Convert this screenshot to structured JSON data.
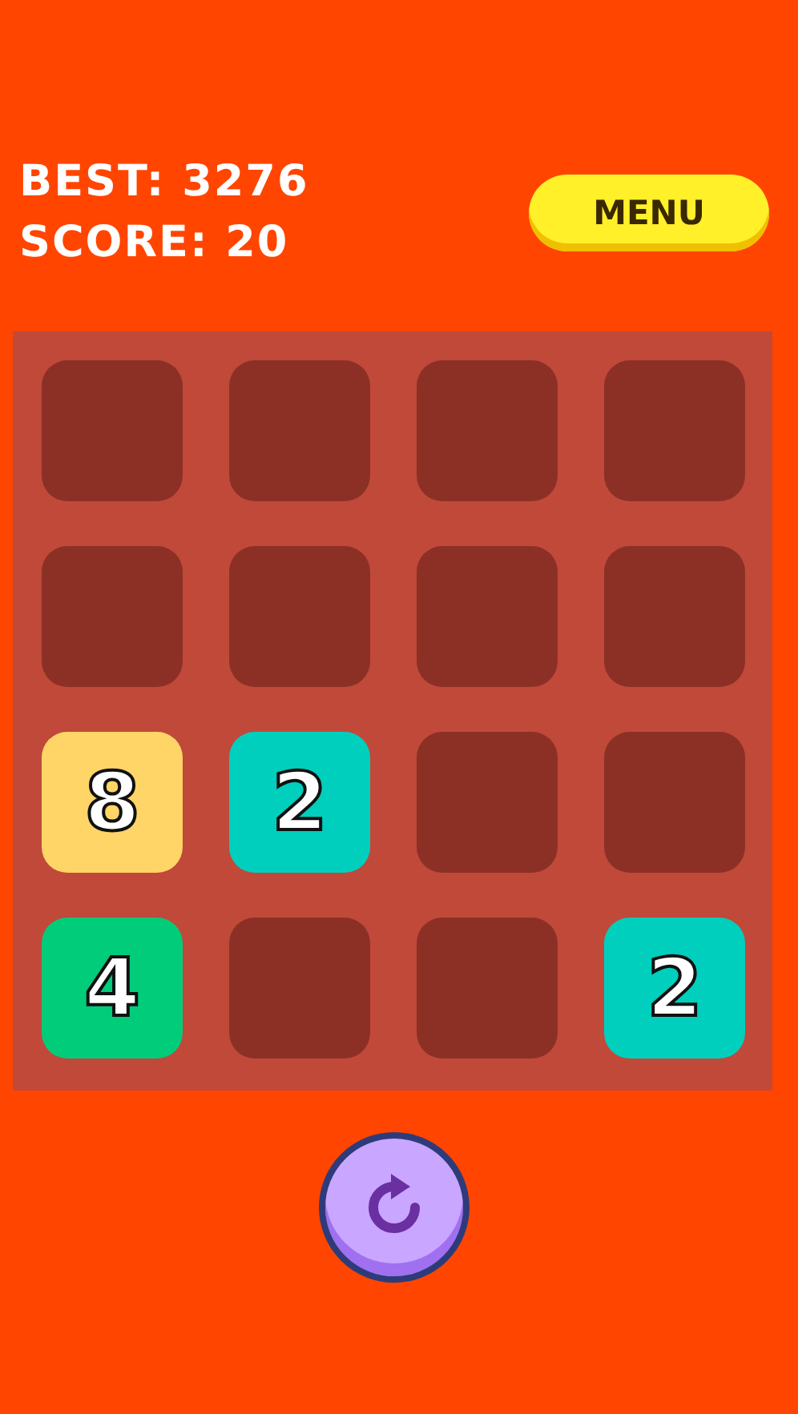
{
  "scores": {
    "best": "BEST: 3276",
    "score": "SCORE: 20"
  },
  "menu_button": {
    "label": "MENU"
  },
  "board": {
    "cells": [
      {
        "kind": "empty"
      },
      {
        "kind": "empty"
      },
      {
        "kind": "empty"
      },
      {
        "kind": "empty"
      },
      {
        "kind": "empty"
      },
      {
        "kind": "empty"
      },
      {
        "kind": "empty"
      },
      {
        "kind": "empty"
      },
      {
        "kind": "tile",
        "value": "8",
        "color": "#ffd567"
      },
      {
        "kind": "tile",
        "value": "2",
        "color": "#00cfbd"
      },
      {
        "kind": "empty"
      },
      {
        "kind": "empty"
      },
      {
        "kind": "tile",
        "value": "4",
        "color": "#00cc7a"
      },
      {
        "kind": "empty"
      },
      {
        "kind": "empty"
      },
      {
        "kind": "tile",
        "value": "2",
        "color": "#00cfbd"
      }
    ]
  }
}
